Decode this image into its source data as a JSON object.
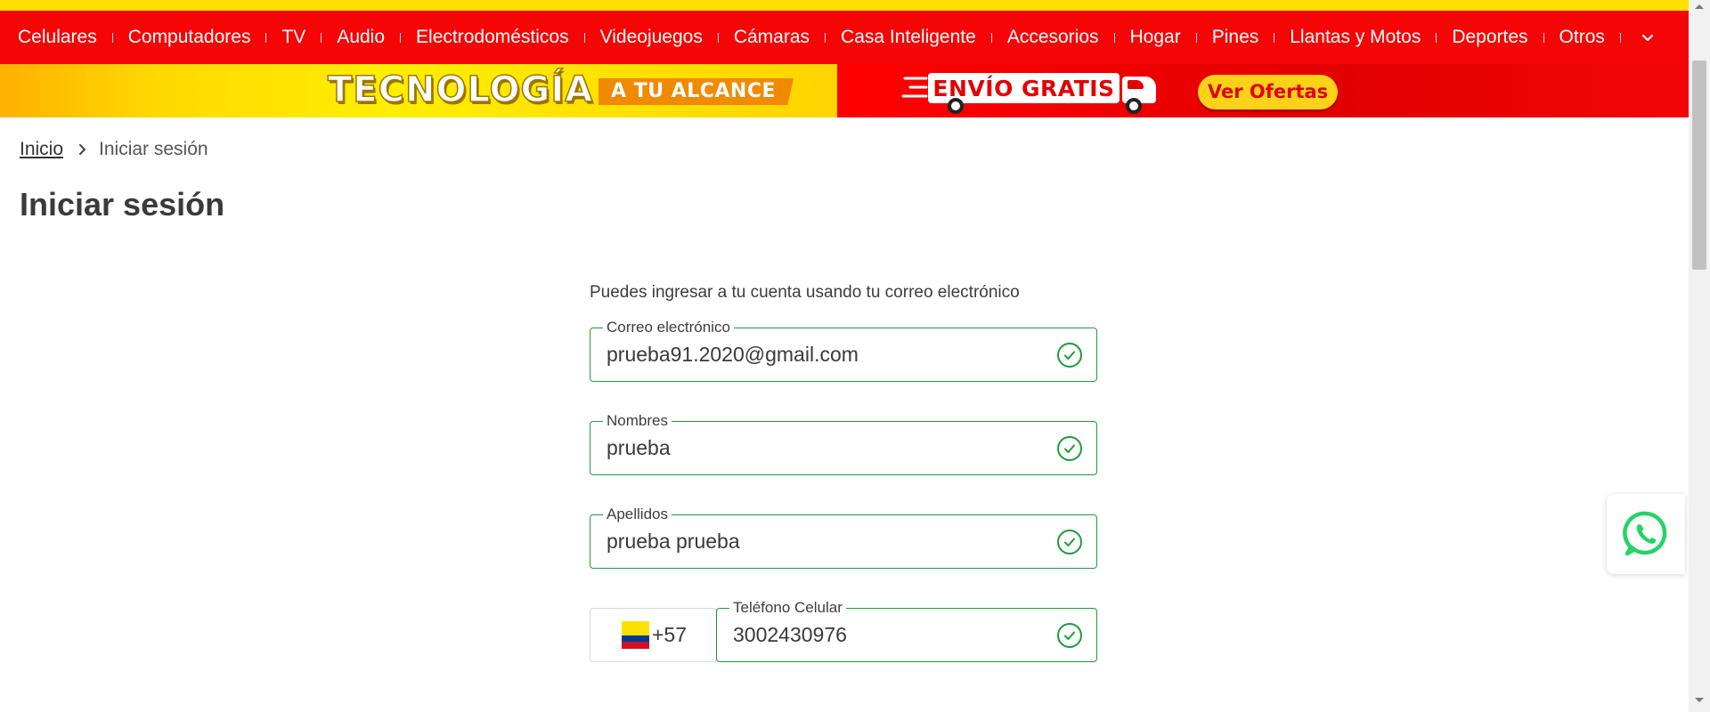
{
  "nav": {
    "items": [
      "Celulares",
      "Computadores",
      "TV",
      "Audio",
      "Electrodomésticos",
      "Videojuegos",
      "Cámaras",
      "Casa Inteligente",
      "Accesorios",
      "Hogar",
      "Pines",
      "Llantas y Motos",
      "Deportes",
      "Otros"
    ],
    "more_icon": "chevron-down-icon"
  },
  "banner": {
    "headline": "TECNOLOGÍA",
    "tagline": "A TU ALCANCE",
    "shipping": "ENVÍO GRATIS",
    "cta": "Ver Ofertas"
  },
  "breadcrumb": {
    "home": "Inicio",
    "current": "Iniciar sesión"
  },
  "page": {
    "title": "Iniciar sesión"
  },
  "form": {
    "intro": "Puedes ingresar a tu cuenta usando tu correo electrónico",
    "email": {
      "label": "Correo electrónico",
      "value": "prueba91.2020@gmail.com"
    },
    "first_name": {
      "label": "Nombres",
      "value": "prueba"
    },
    "last_name": {
      "label": "Apellidos",
      "value": "prueba prueba"
    },
    "phone": {
      "country_code": "+57",
      "label": "Teléfono Celular",
      "value": "3002430976"
    }
  },
  "colors": {
    "brand_red": "#f50505",
    "brand_yellow": "#ffe000",
    "valid_green": "#1f9b3a",
    "whatsapp_green": "#25d366"
  },
  "icons": {
    "valid": "check-circle-icon",
    "chat": "whatsapp-icon",
    "flag": "colombia-flag-icon"
  }
}
